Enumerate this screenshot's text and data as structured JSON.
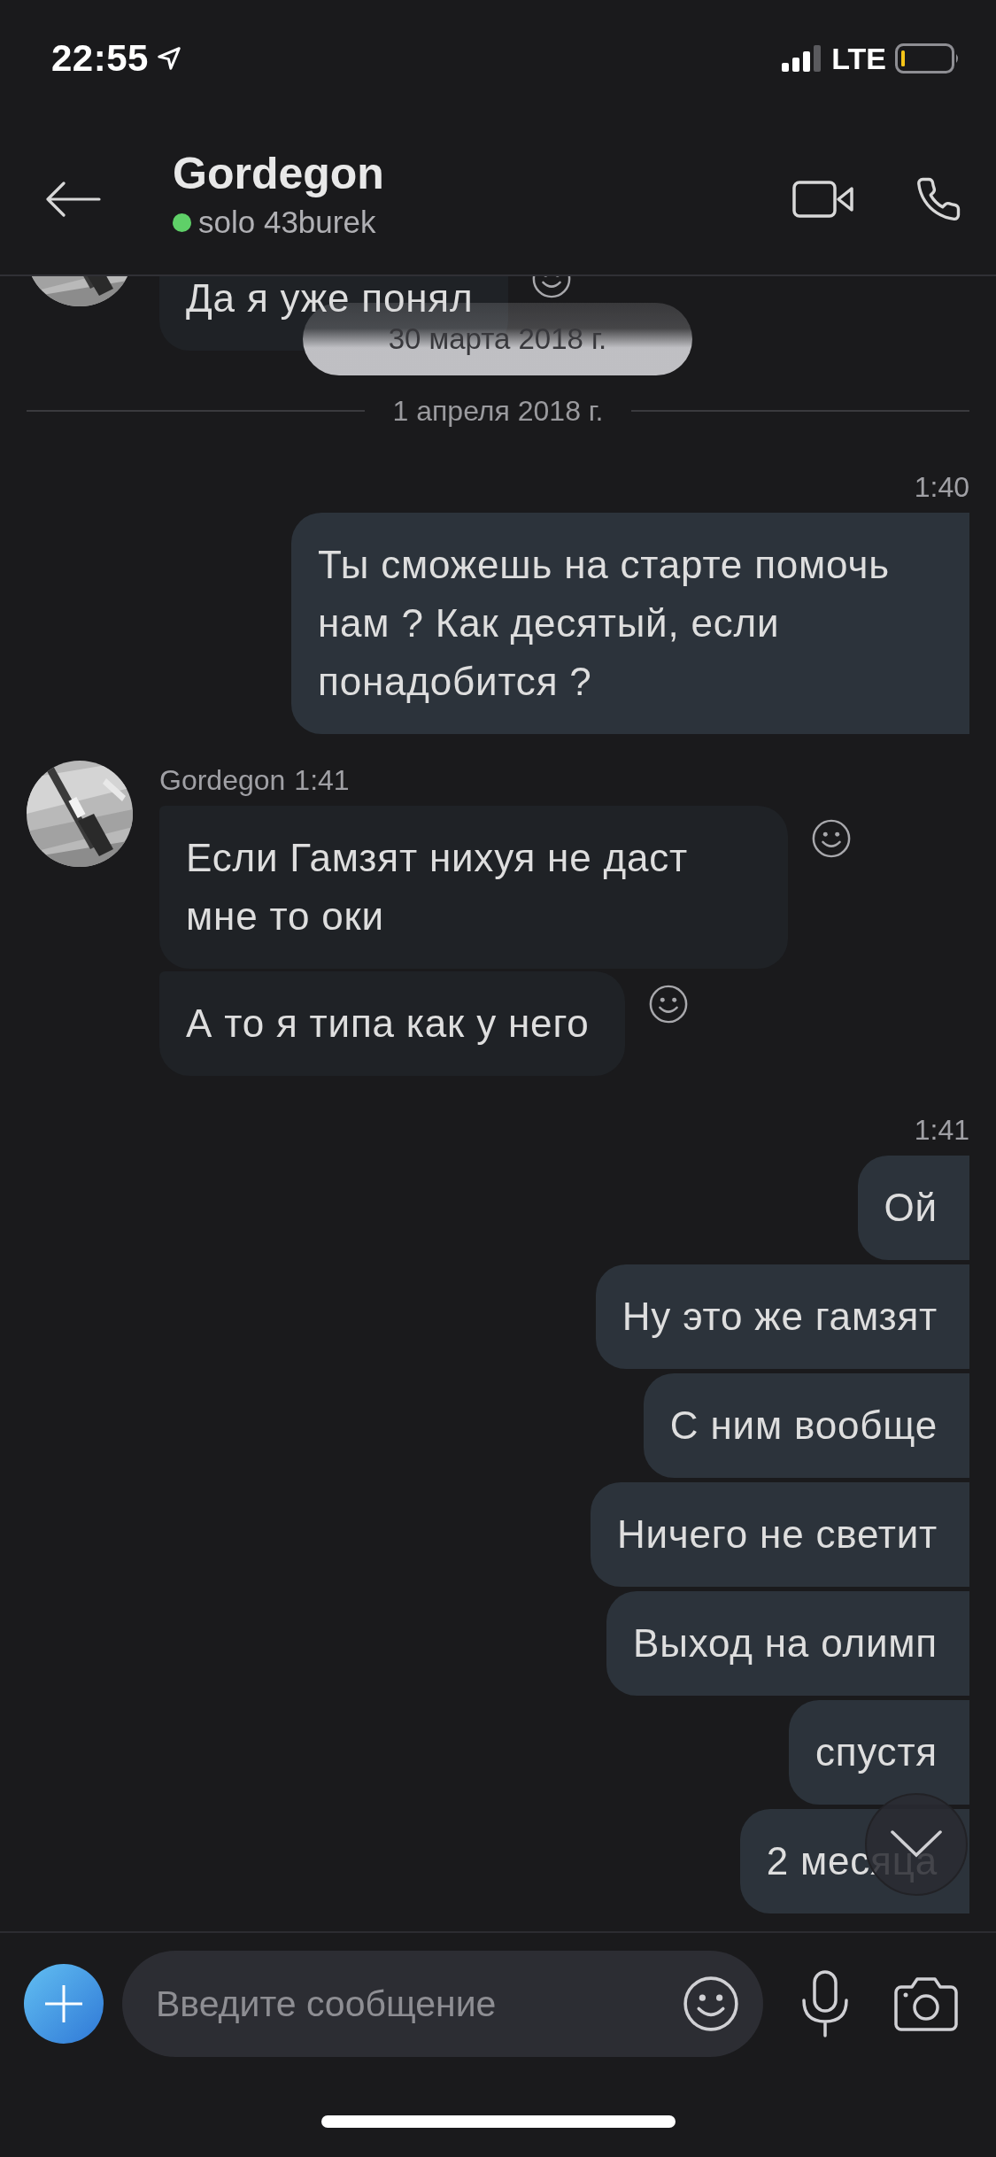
{
  "status_bar": {
    "time": "22:55",
    "network": "LTE"
  },
  "header": {
    "title": "Gordegon",
    "status": "solo 43burek",
    "online": true
  },
  "floating_date": "30 марта 2018 г.",
  "messages": [
    {
      "kind": "incoming",
      "bubbles": [
        "Да я уже понял"
      ]
    },
    {
      "kind": "date_divider",
      "label": "1 апреля 2018 г."
    },
    {
      "kind": "outgoing",
      "time": "1:40",
      "bubbles": [
        "Ты сможешь на старте помочь нам ? Как десятый, если понадобится ?"
      ]
    },
    {
      "kind": "incoming",
      "sender": "Gordegon",
      "time": "1:41",
      "bubbles": [
        "Если Гамзят нихуя не даст мне то оки",
        "А то я типа как у него"
      ]
    },
    {
      "kind": "outgoing",
      "time": "1:41",
      "bubbles": [
        "Ой",
        "Ну это же гамзят",
        "С ним вообще",
        "Ничего не светит",
        "Выход на олимп",
        "спустя",
        "2 месяца"
      ]
    }
  ],
  "composer": {
    "placeholder": "Введите сообщение"
  }
}
